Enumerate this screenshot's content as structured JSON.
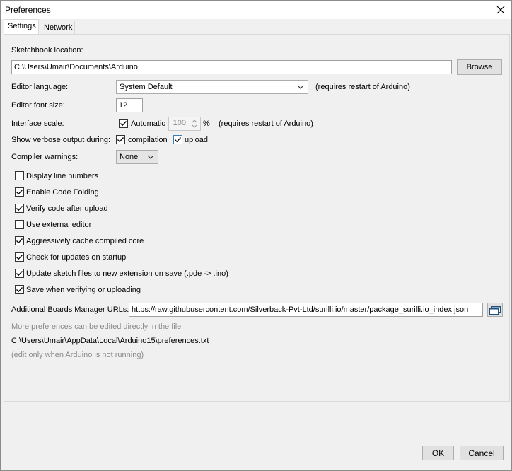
{
  "window": {
    "title": "Preferences"
  },
  "tabs": [
    {
      "label": "Settings",
      "active": true
    },
    {
      "label": "Network",
      "active": false
    }
  ],
  "sketchbook": {
    "label": "Sketchbook location:",
    "value": "C:\\Users\\Umair\\Documents\\Arduino",
    "browse_label": "Browse"
  },
  "editor_language": {
    "label": "Editor language:",
    "value": "System Default",
    "note": "(requires restart of Arduino)"
  },
  "font_size": {
    "label": "Editor font size:",
    "value": "12"
  },
  "interface_scale": {
    "label": "Interface scale:",
    "automatic_label": "Automatic",
    "automatic_checked": true,
    "value": "100",
    "unit": "%",
    "note": "(requires restart of Arduino)"
  },
  "verbose": {
    "label": "Show verbose output during:",
    "compilation_label": "compilation",
    "compilation_checked": true,
    "upload_label": "upload",
    "upload_checked": true
  },
  "compiler_warnings": {
    "label": "Compiler warnings:",
    "value": "None"
  },
  "options": [
    {
      "label": "Display line numbers",
      "checked": false
    },
    {
      "label": "Enable Code Folding",
      "checked": true
    },
    {
      "label": "Verify code after upload",
      "checked": true
    },
    {
      "label": "Use external editor",
      "checked": false
    },
    {
      "label": "Aggressively cache compiled core",
      "checked": true
    },
    {
      "label": "Check for updates on startup",
      "checked": true
    },
    {
      "label": "Update sketch files to new extension on save (.pde -> .ino)",
      "checked": true
    },
    {
      "label": "Save when verifying or uploading",
      "checked": true
    }
  ],
  "boards_urls": {
    "label": "Additional Boards Manager URLs:",
    "value": "https://raw.githubusercontent.com/Silverback-Pvt-Ltd/surilli.io/master/package_surilli.io_index.json"
  },
  "footer_info": {
    "more_prefs": "More preferences can be edited directly in the file",
    "file_path": "C:\\Users\\Umair\\AppData\\Local\\Arduino15\\preferences.txt",
    "edit_note": "(edit only when Arduino is not running)"
  },
  "buttons": {
    "ok": "OK",
    "cancel": "Cancel"
  },
  "icons": {
    "close": "close-icon",
    "dropdown": "chevron-down-icon",
    "check": "checkmark-icon",
    "window": "window-icon"
  }
}
